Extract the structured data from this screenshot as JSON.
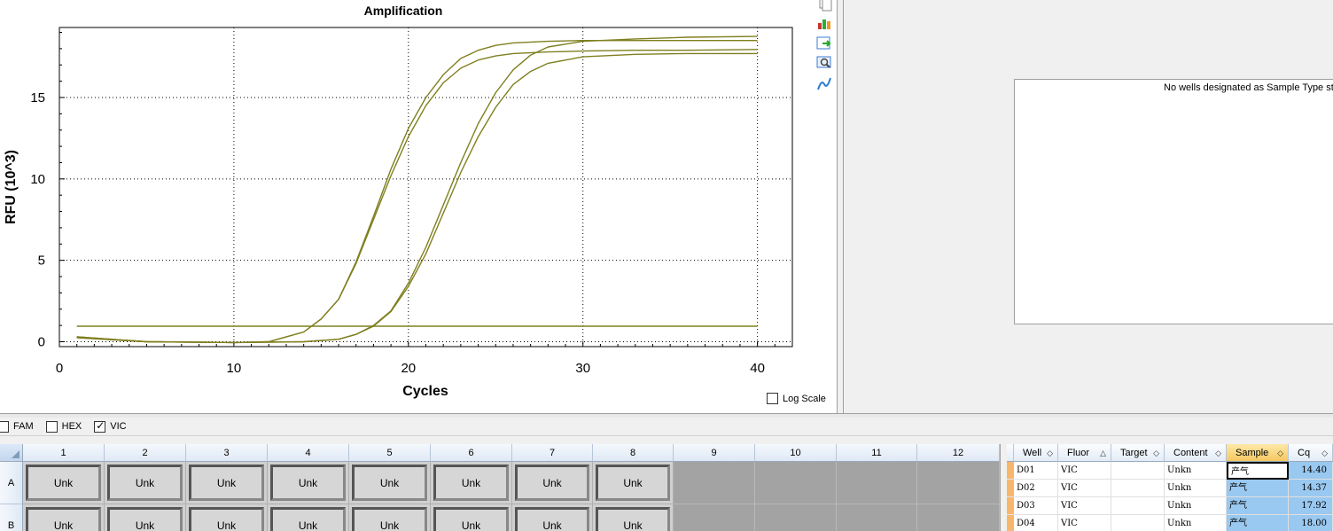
{
  "chart": {
    "title": "Amplification",
    "xlabel": "Cycles",
    "ylabel": "RFU (10^3)",
    "log_scale_label": "Log Scale"
  },
  "chart_data": {
    "type": "line",
    "title": "Amplification",
    "xlabel": "Cycles",
    "ylabel": "RFU (10^3)",
    "xlim": [
      0,
      42
    ],
    "ylim": [
      -0.3,
      19.3
    ],
    "xticks": [
      0,
      10,
      20,
      30,
      40
    ],
    "yticks": [
      0,
      5,
      10,
      15
    ],
    "grid": true,
    "line_color": "#7f7f1f",
    "series": [
      {
        "x": [
          1,
          5,
          10,
          12,
          14,
          15,
          16,
          17,
          18,
          19,
          20,
          21,
          22,
          23,
          24,
          25,
          26,
          28,
          30,
          33,
          36,
          40
        ],
        "values": [
          0.3,
          0.0,
          -0.05,
          0.0,
          0.6,
          1.4,
          2.6,
          4.9,
          7.7,
          10.6,
          13.1,
          15.0,
          16.4,
          17.4,
          17.9,
          18.2,
          18.35,
          18.45,
          18.5,
          18.5,
          18.5,
          18.5
        ]
      },
      {
        "x": [
          1,
          5,
          10,
          12,
          14,
          15,
          16,
          17,
          18,
          19,
          20,
          21,
          22,
          23,
          24,
          25,
          26,
          28,
          30,
          33,
          36,
          40
        ],
        "values": [
          0.3,
          0.0,
          -0.05,
          0.0,
          0.6,
          1.4,
          2.6,
          4.8,
          7.5,
          10.2,
          12.6,
          14.5,
          15.9,
          16.8,
          17.3,
          17.55,
          17.7,
          17.8,
          17.85,
          17.9,
          17.9,
          17.95
        ]
      },
      {
        "x": [
          1,
          5,
          10,
          14,
          16,
          17,
          18,
          19,
          20,
          21,
          22,
          23,
          24,
          25,
          26,
          27,
          28,
          30,
          33,
          36,
          40
        ],
        "values": [
          0.25,
          0.0,
          -0.05,
          0.0,
          0.15,
          0.45,
          1.0,
          1.9,
          3.6,
          5.8,
          8.4,
          11.0,
          13.4,
          15.3,
          16.7,
          17.6,
          18.1,
          18.45,
          18.6,
          18.7,
          18.75
        ]
      },
      {
        "x": [
          1,
          5,
          10,
          14,
          16,
          17,
          18,
          19,
          20,
          21,
          22,
          23,
          24,
          25,
          26,
          27,
          28,
          30,
          33,
          36,
          40
        ],
        "values": [
          0.25,
          0.0,
          -0.05,
          0.0,
          0.15,
          0.45,
          0.95,
          1.85,
          3.4,
          5.4,
          7.9,
          10.4,
          12.6,
          14.4,
          15.8,
          16.6,
          17.1,
          17.5,
          17.65,
          17.7,
          17.7
        ]
      },
      {
        "x": [
          1,
          40
        ],
        "values": [
          0.95,
          0.95
        ]
      }
    ]
  },
  "toolbar": {
    "icons": [
      "copy-icon",
      "chart-settings-icon",
      "export-icon",
      "zoom-icon",
      "curve-icon"
    ]
  },
  "standard_curve": {
    "message": "No wells designated as Sample Type sta"
  },
  "fluorophores": [
    {
      "label": "FAM",
      "checked": false
    },
    {
      "label": "HEX",
      "checked": false
    },
    {
      "label": "VIC",
      "checked": true
    }
  ],
  "plate": {
    "columns": [
      "1",
      "2",
      "3",
      "4",
      "5",
      "6",
      "7",
      "8",
      "9",
      "10",
      "11",
      "12"
    ],
    "rows": [
      "A",
      "B"
    ],
    "wells": {
      "A": [
        "Unk",
        "Unk",
        "Unk",
        "Unk",
        "Unk",
        "Unk",
        "Unk",
        "Unk",
        "",
        "",
        "",
        ""
      ],
      "B": [
        "Unk",
        "Unk",
        "Unk",
        "Unk",
        "Unk",
        "Unk",
        "Unk",
        "Unk",
        "",
        "",
        "",
        ""
      ]
    }
  },
  "results_table": {
    "headers": [
      "Well",
      "Fluor",
      "Target",
      "Content",
      "Sample",
      "Cq"
    ],
    "sort_markers": [
      "◇",
      "△",
      "◇",
      "◇",
      "◇",
      "◇"
    ],
    "rows": [
      [
        "D01",
        "VIC",
        "",
        "Unkn",
        "产气",
        "14.40"
      ],
      [
        "D02",
        "VIC",
        "",
        "Unkn",
        "产气",
        "14.37"
      ],
      [
        "D03",
        "VIC",
        "",
        "Unkn",
        "产气",
        "17.92"
      ],
      [
        "D04",
        "VIC",
        "",
        "Unkn",
        "产气",
        "18.00"
      ]
    ]
  }
}
